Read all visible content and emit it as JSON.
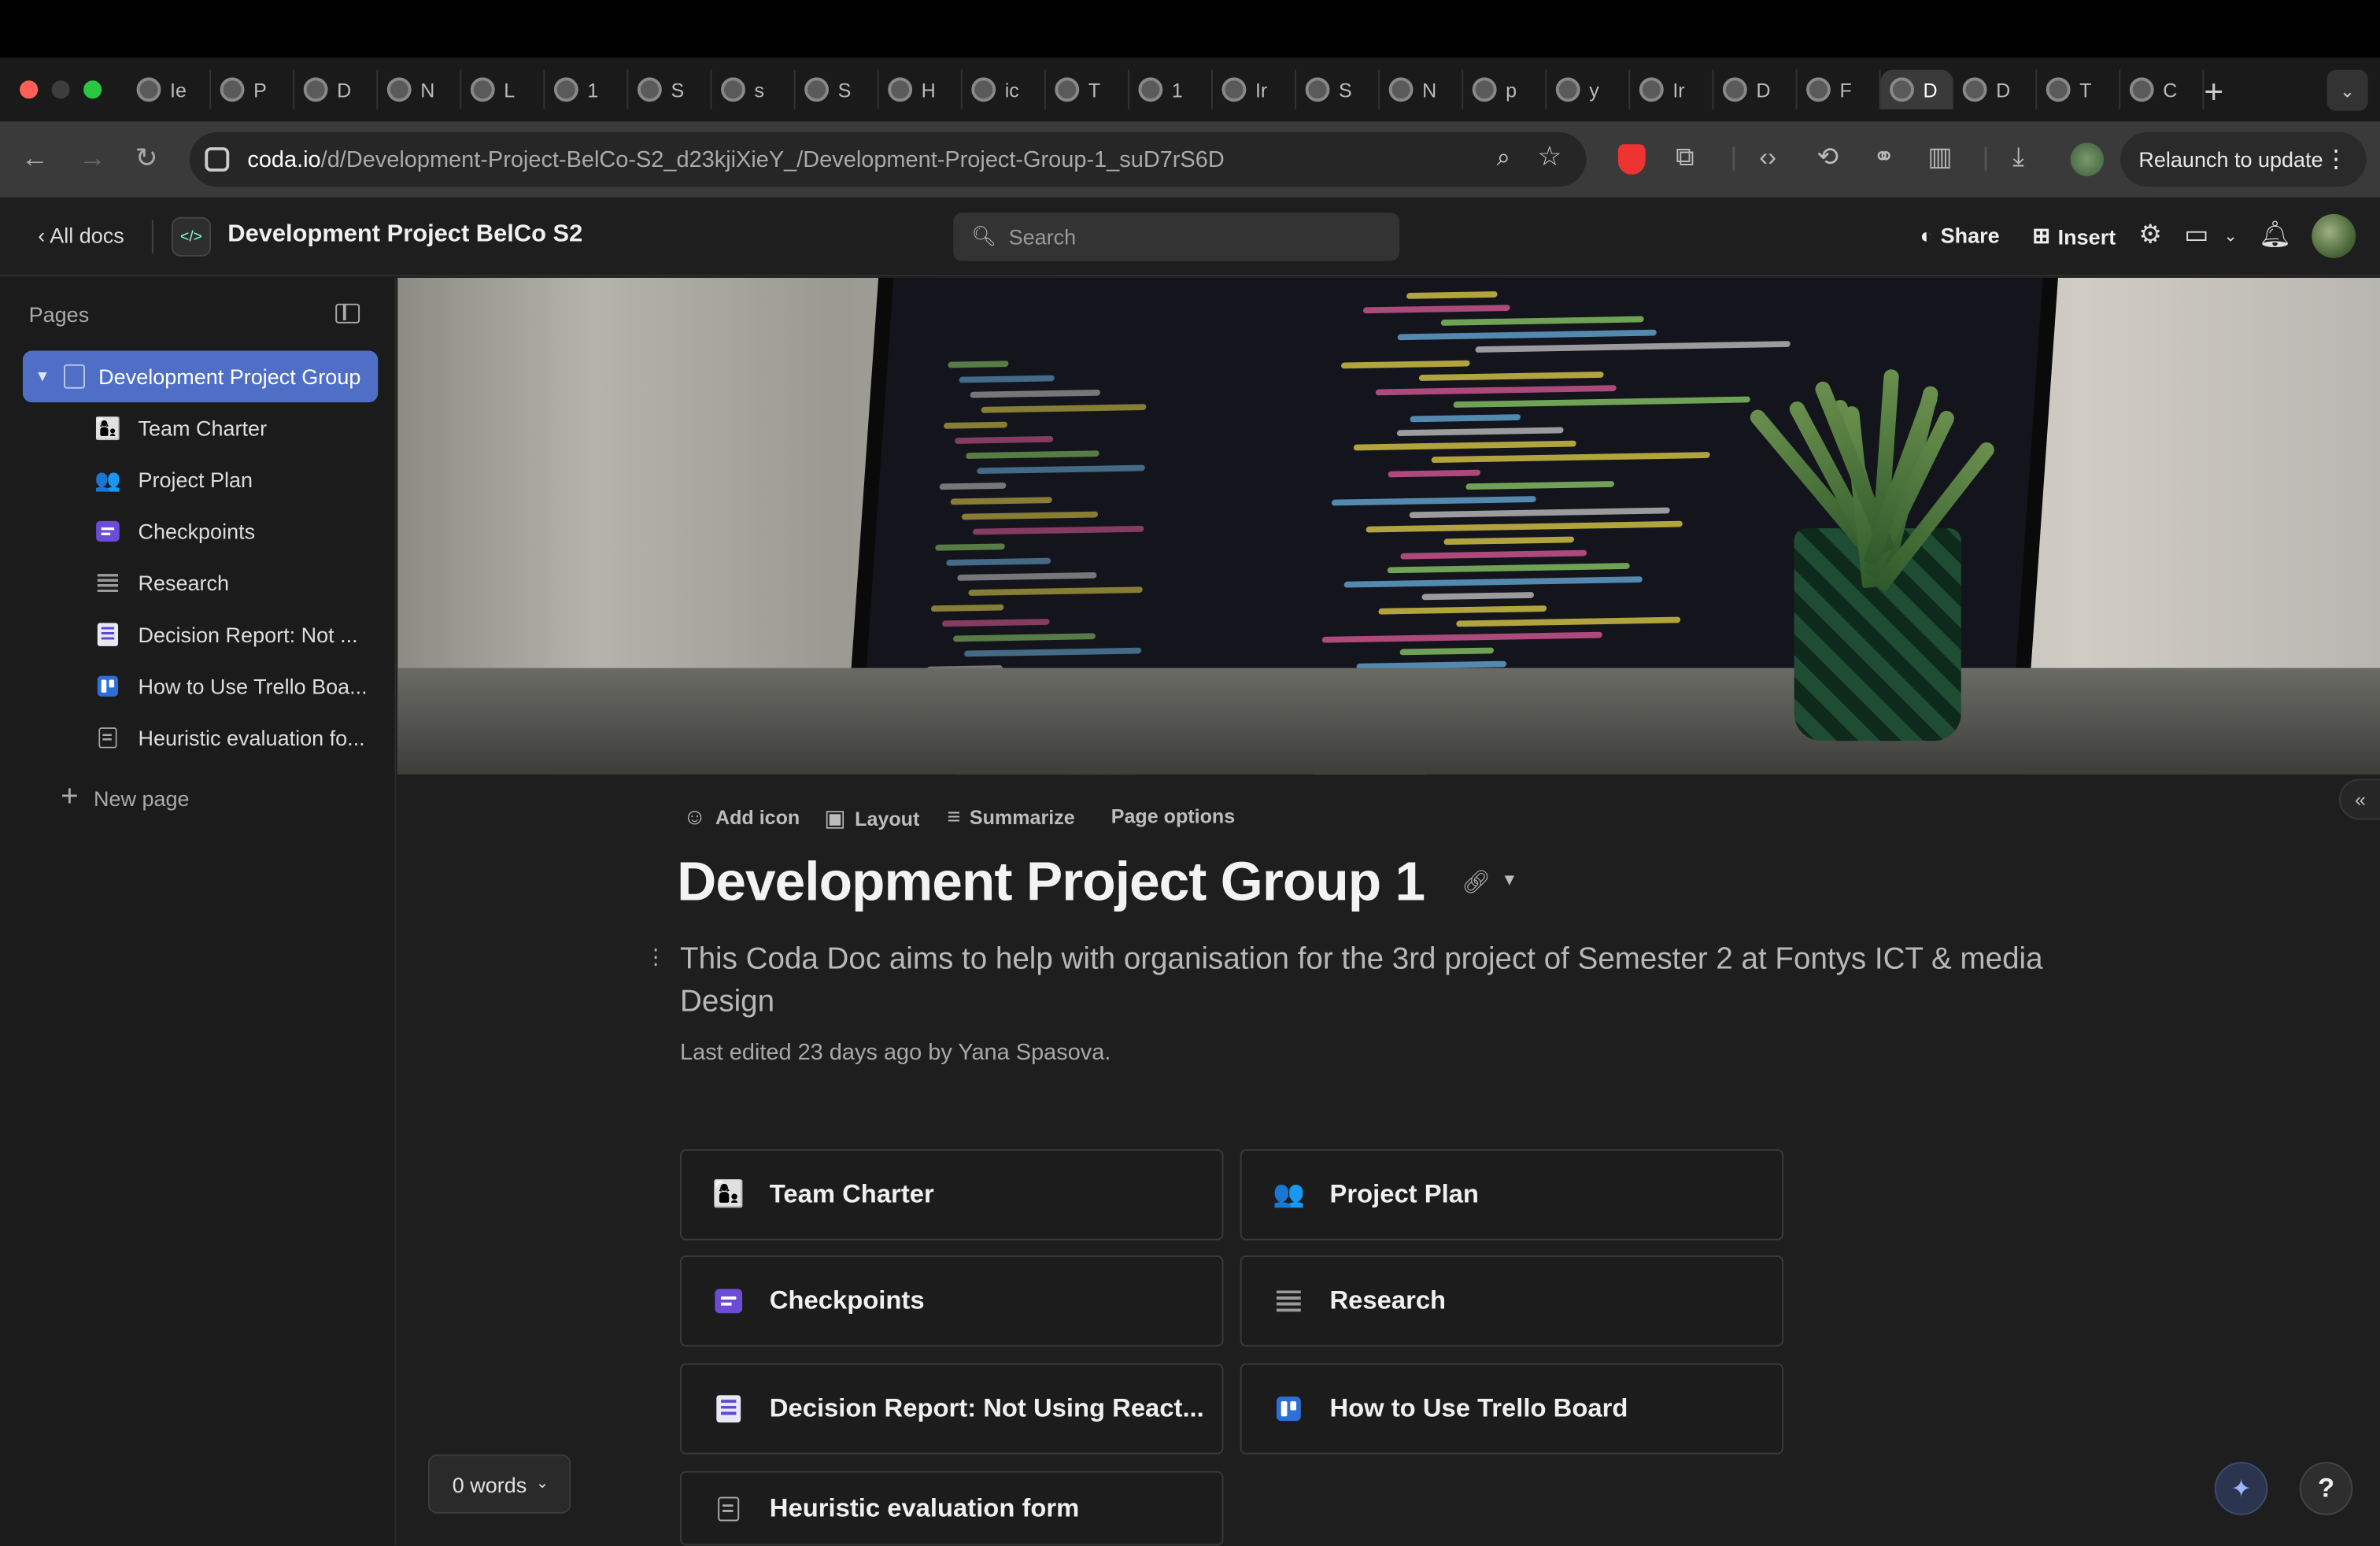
{
  "browser": {
    "tabs": [
      {
        "label": "Ie"
      },
      {
        "label": "P"
      },
      {
        "label": "D"
      },
      {
        "label": "N"
      },
      {
        "label": "L"
      },
      {
        "label": "1"
      },
      {
        "label": "S"
      },
      {
        "label": "s"
      },
      {
        "label": "S"
      },
      {
        "label": "H"
      },
      {
        "label": "ic"
      },
      {
        "label": "T"
      },
      {
        "label": "1"
      },
      {
        "label": "Ir"
      },
      {
        "label": "S"
      },
      {
        "label": "N"
      },
      {
        "label": "p"
      },
      {
        "label": "y"
      },
      {
        "label": "Ir"
      },
      {
        "label": "D"
      },
      {
        "label": "F"
      }
    ],
    "active_tab": {
      "label": "D",
      "close": "✕"
    },
    "tabs_after": [
      {
        "label": "D"
      },
      {
        "label": "T"
      },
      {
        "label": "C"
      }
    ],
    "new_tab": "+",
    "url_host": "coda.io",
    "url_path": "/d/Development-Project-BelCo-S2_d23kjiXieY_/Development-Project-Group-1_suD7rS6D",
    "relaunch_label": "Relaunch to update"
  },
  "header": {
    "all_docs": "All docs",
    "doc_title": "Development Project BelCo S2",
    "search_placeholder": "Search",
    "share": "Share",
    "insert": "Insert"
  },
  "sidebar": {
    "pages_label": "Pages",
    "active_page": "Development Project Group",
    "items": [
      {
        "icon": "team-emoji",
        "glyph": "👩‍👦",
        "label": "Team Charter"
      },
      {
        "icon": "people-emoji",
        "glyph": "👥",
        "label": "Project Plan"
      },
      {
        "icon": "checkpoints-icon",
        "glyph": "",
        "label": "Checkpoints"
      },
      {
        "icon": "lines-icon",
        "glyph": "",
        "label": "Research"
      },
      {
        "icon": "report-icon",
        "glyph": "",
        "label": "Decision Report: Not ..."
      },
      {
        "icon": "trello-icon",
        "glyph": "",
        "label": "How to Use Trello Boa..."
      },
      {
        "icon": "form-icon",
        "glyph": "",
        "label": "Heuristic evaluation fo..."
      }
    ],
    "new_page": "New page"
  },
  "page": {
    "options": {
      "add_icon": "Add icon",
      "layout": "Layout",
      "summarize": "Summarize",
      "page_options": "Page options"
    },
    "title": "Development Project Group 1",
    "description": "This Coda Doc aims to help with organisation for the 3rd project of Semester 2 at Fontys ICT & media Design",
    "last_edited": "Last edited 23 days ago by Yana Spasova.",
    "cards": [
      {
        "label": "Team Charter"
      },
      {
        "label": "Project Plan"
      },
      {
        "label": "Checkpoints"
      },
      {
        "label": "Research"
      },
      {
        "label": "Decision Report: Not Using React..."
      },
      {
        "label": "How to Use Trello Board"
      },
      {
        "label": "Heuristic evaluation form"
      }
    ]
  },
  "footer": {
    "words": "0 words",
    "help": "?"
  }
}
